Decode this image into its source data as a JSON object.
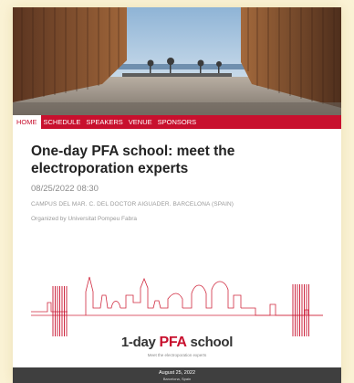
{
  "nav": {
    "items": [
      {
        "label": "HOME",
        "active": true
      },
      {
        "label": "SCHEDULE",
        "active": false
      },
      {
        "label": "SPEAKERS",
        "active": false
      },
      {
        "label": "VENUE",
        "active": false
      },
      {
        "label": "SPONSORS",
        "active": false
      }
    ]
  },
  "event": {
    "title": "One-day PFA school: meet the electroporation experts",
    "datetime": "08/25/2022 08:30",
    "location": "CAMPUS DEL MAR. C. DEL DOCTOR AIGUADER. BARCELONA (SPAIN)",
    "organizer": "Organized by Universitat Pompeu Fabra"
  },
  "poster": {
    "logo_prefix": "1-day ",
    "logo_highlight": "PFA",
    "logo_suffix": " school",
    "tagline": "Meet the electroporation experts"
  },
  "footer_band": {
    "date": "August 25, 2022",
    "city": "Barcelona, Spain"
  },
  "colors": {
    "accent": "#c8102e",
    "page_background": "#fbf3d6",
    "footer_band": "#3f3f3f"
  }
}
